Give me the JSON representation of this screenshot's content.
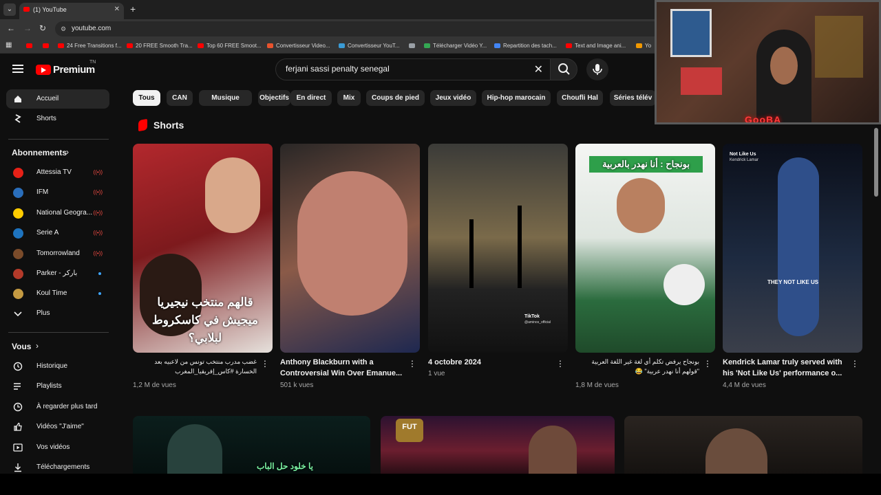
{
  "browser": {
    "tab_title": "(1) YouTube",
    "tab_close": "✕",
    "new_tab": "+",
    "url": "youtube.com",
    "bookmarks": [
      {
        "label": "",
        "color": "#ff0000"
      },
      {
        "label": "",
        "color": "#ff0000"
      },
      {
        "label": "24 Free Transitions f...",
        "color": "#ff0000"
      },
      {
        "label": "20 FREE Smooth Tra...",
        "color": "#ff0000"
      },
      {
        "label": "Top 60 FREE Smoot...",
        "color": "#ff0000"
      },
      {
        "label": "Convertisseur Video...",
        "color": "#e8532d"
      },
      {
        "label": "Convertisseur YouT...",
        "color": "#3a9bd5"
      },
      {
        "label": "",
        "color": "#9aa0a6"
      },
      {
        "label": "Télécharger Vidéo Y...",
        "color": "#34a853"
      },
      {
        "label": "Repartition des tach...",
        "color": "#4285f4"
      },
      {
        "label": "Text and Image ani...",
        "color": "#ff0000"
      },
      {
        "label": "Yo",
        "color": "#f29900"
      }
    ]
  },
  "header": {
    "logo_text": "Premium",
    "logo_sup": "TN",
    "search_value": "ferjani sassi penalty senegal",
    "clear_icon": "✕"
  },
  "sidebar": {
    "main": [
      {
        "label": "Accueil",
        "icon": "home-icon",
        "active": true
      },
      {
        "label": "Shorts",
        "icon": "shorts-icon",
        "active": false
      }
    ],
    "subscriptions_heading": "Abonnements",
    "subscriptions": [
      {
        "label": "Attessia TV",
        "avatar_color": "#e62117",
        "live": true
      },
      {
        "label": "IFM",
        "avatar_color": "#2a6ebb",
        "live": true
      },
      {
        "label": "National Geogra...",
        "avatar_color": "#ffcc00",
        "live": true
      },
      {
        "label": "Serie A",
        "avatar_color": "#1e73be",
        "live": true
      },
      {
        "label": "Tomorrowland",
        "avatar_color": "#7a4b2a",
        "live": true
      },
      {
        "label": "Parker - باركر",
        "avatar_color": "#b33a2a",
        "live": false,
        "new": true
      },
      {
        "label": "Koul Time",
        "avatar_color": "#c49a42",
        "live": false,
        "new": true
      }
    ],
    "more_label": "Plus",
    "you_heading": "Vous",
    "you_items": [
      {
        "label": "Historique",
        "icon": "history-icon"
      },
      {
        "label": "Playlists",
        "icon": "playlists-icon"
      },
      {
        "label": "À regarder plus tard",
        "icon": "watch-later-icon"
      },
      {
        "label": "Vidéos \"J'aime\"",
        "icon": "like-icon"
      },
      {
        "label": "Vos vidéos",
        "icon": "your-videos-icon"
      },
      {
        "label": "Téléchargements",
        "icon": "download-icon"
      }
    ],
    "live_glyph": "((•))"
  },
  "chips": [
    "Tous",
    "CAN",
    "Musique",
    "Objectifs",
    "En direct",
    "Mix",
    "Coups de pied",
    "Jeux vidéo",
    "Hip-hop marocain",
    "Choufli Hal",
    "Séries télév"
  ],
  "shorts": {
    "title": "Shorts",
    "items": [
      {
        "title": "غضب مدرب منتخب تونس من لاعبيه بعد الخسارة #كاس_إفريقيا_المغرب",
        "views": "1,2 M de vues",
        "rtl": true,
        "overlay": "قالهم منتخب نيجيريا ميجيش في كاسكروط لبلابي؟"
      },
      {
        "title": "Anthony Blackburn with a Controversial Win Over Emanue...",
        "views": "501 k vues",
        "rtl": false,
        "overlay": ""
      },
      {
        "title": "4 octobre 2024",
        "views": "1 vue",
        "rtl": false,
        "overlay": "",
        "tag": "TikTok",
        "tag_sub": "@aminos_official"
      },
      {
        "title": "بونجاح يرفض تكلم أي لغة غير اللغة العربية \"قولهم أنا نهدر عربية\" 😂",
        "views": "1,8 M de vues",
        "rtl": true,
        "overlay": "بونجاح : أنا نهدر بالعربية"
      },
      {
        "title": "Kendrick Lamar truly served with his 'Not Like Us' performance o...",
        "views": "4,4 M de vues",
        "rtl": false,
        "overlay": "",
        "tag": "Not Like Us",
        "tag_sub": "Kendrick Lamar",
        "caption": "THEY NOT LIKE US"
      }
    ]
  },
  "lower_row": [
    {
      "caption": "يا خلود حل الباب"
    },
    {
      "badge": "FUT"
    },
    {}
  ],
  "webcam": {
    "name": "GooBA"
  }
}
